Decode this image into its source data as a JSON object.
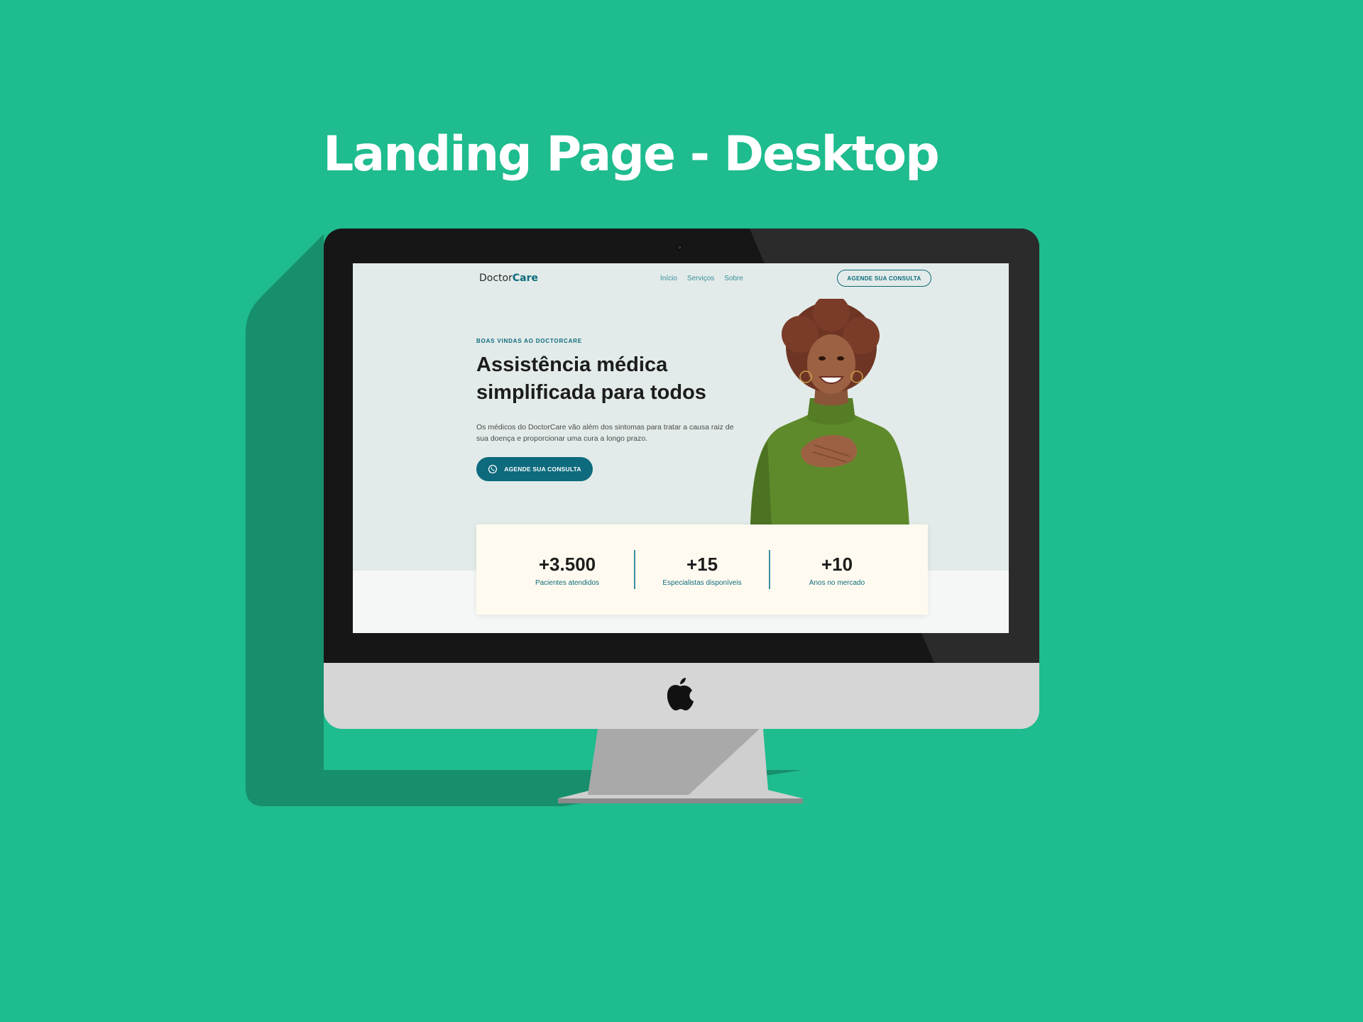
{
  "showcase": {
    "title": "Landing Page - Desktop"
  },
  "colors": {
    "background": "#1ebc8e",
    "brand": "#0d6b7d",
    "hero_bg": "#e2ebe9",
    "card_bg": "#fffaef"
  },
  "site": {
    "logo": {
      "part1": "Doctor",
      "part2": "Care"
    },
    "nav": {
      "items": [
        "Início",
        "Serviços",
        "Sobre"
      ]
    },
    "header_cta": "AGENDE SUA CONSULTA",
    "hero": {
      "eyebrow": "BOAS VINDAS AO DOCTORCARE",
      "headline": "Assistência médica simplificada para todos",
      "description": "Os médicos do DoctorCare vão além dos sintomas para tratar a causa raiz de sua doença e proporcionar uma cura a longo prazo.",
      "cta": "AGENDE SUA CONSULTA",
      "cta_icon": "whatsapp-icon"
    },
    "stats": [
      {
        "value": "+3.500",
        "label": "Pacientes atendidos"
      },
      {
        "value": "+15",
        "label": "Especialistas disponíveis"
      },
      {
        "value": "+10",
        "label": "Anos no mercado"
      }
    ]
  },
  "device": {
    "logo_icon": "apple-logo-icon",
    "camera_icon": "camera-icon"
  }
}
